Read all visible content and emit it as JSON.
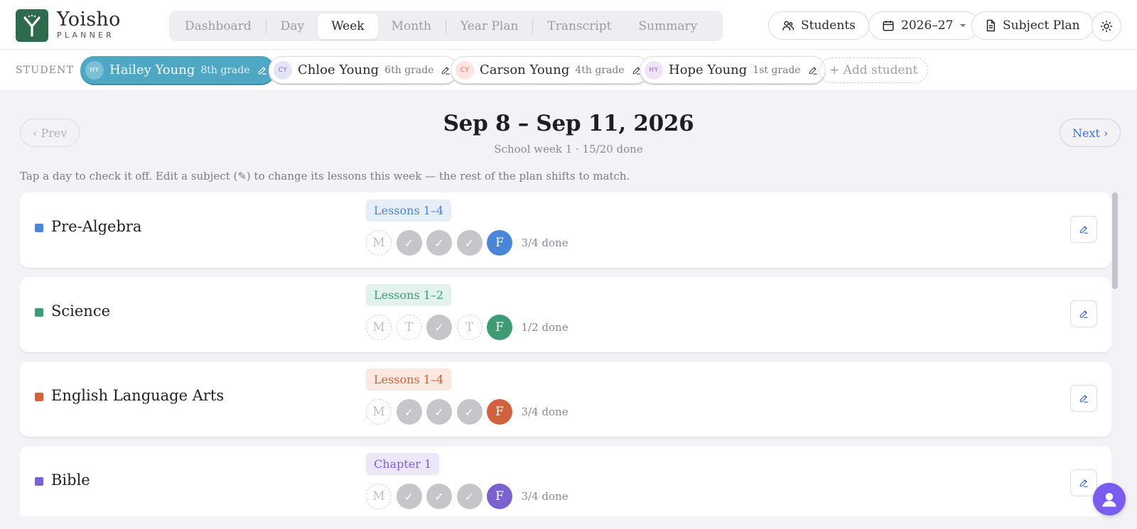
{
  "brand": {
    "name": "Yoisho",
    "subtitle": "PLANNER",
    "color": "#2e6b4e"
  },
  "tabs": [
    {
      "label": "Dashboard",
      "active": false
    },
    {
      "label": "Day",
      "active": false
    },
    {
      "label": "Week",
      "active": true
    },
    {
      "label": "Month",
      "active": false
    },
    {
      "label": "Year Plan",
      "active": false
    },
    {
      "label": "Transcript",
      "active": false
    },
    {
      "label": "Summary",
      "active": false
    }
  ],
  "header_actions": {
    "students_label": "Students",
    "year_label": "2026–27",
    "subject_plan_label": "Subject Plan",
    "theme_icon": "sun-icon"
  },
  "students": {
    "label": "STUDENT",
    "items": [
      {
        "initials": "HY",
        "name": "Hailey Young",
        "grade": "8th grade",
        "active": true,
        "avatar_bg": "#7cc0d6",
        "avatar_fg": "#ffffff"
      },
      {
        "initials": "CY",
        "name": "Chloe Young",
        "grade": "6th grade",
        "active": false,
        "avatar_bg": "#e5e3f7",
        "avatar_fg": "#7a6fc7"
      },
      {
        "initials": "CY",
        "name": "Carson Young",
        "grade": "4th grade",
        "active": false,
        "avatar_bg": "#fde4de",
        "avatar_fg": "#d96b55"
      },
      {
        "initials": "HY",
        "name": "Hope Young",
        "grade": "1st grade",
        "active": false,
        "avatar_bg": "#f1e3f7",
        "avatar_fg": "#a25cc4"
      }
    ],
    "add_label": "+ Add student"
  },
  "week": {
    "prev_label": "‹ Prev",
    "next_label": "Next ›",
    "title": "Sep 8 – Sep 11, 2026",
    "subtitle": "School week 1 · 15/20 done",
    "hint": "Tap a day to check it off. Edit a subject (✎) to change its lessons this week — the rest of the plan shifts to match."
  },
  "subjects": [
    {
      "name": "Pre-Algebra",
      "color": "#4a86d8",
      "tag_bg": "#e6eefa",
      "tag": "Lessons 1–4",
      "done": "3/4 done",
      "days": [
        {
          "label": "M",
          "state": "todo"
        },
        {
          "label": "✓",
          "state": "checked"
        },
        {
          "label": "✓",
          "state": "checked"
        },
        {
          "label": "✓",
          "state": "checked"
        },
        {
          "label": "F",
          "state": "current"
        }
      ]
    },
    {
      "name": "Science",
      "color": "#3f9b74",
      "tag_bg": "#e3f2eb",
      "tag": "Lessons 1–2",
      "done": "1/2 done",
      "days": [
        {
          "label": "M",
          "state": "todo"
        },
        {
          "label": "T",
          "state": "todo"
        },
        {
          "label": "✓",
          "state": "checked"
        },
        {
          "label": "T",
          "state": "todo"
        },
        {
          "label": "F",
          "state": "current"
        }
      ]
    },
    {
      "name": "English Language Arts",
      "color": "#d0623e",
      "tag_bg": "#fbe8e1",
      "tag": "Lessons 1–4",
      "done": "3/4 done",
      "days": [
        {
          "label": "M",
          "state": "todo"
        },
        {
          "label": "✓",
          "state": "checked"
        },
        {
          "label": "✓",
          "state": "checked"
        },
        {
          "label": "✓",
          "state": "checked"
        },
        {
          "label": "F",
          "state": "current"
        }
      ]
    },
    {
      "name": "Bible",
      "color": "#7a63d0",
      "tag_bg": "#ece8f9",
      "tag": "Chapter 1",
      "done": "3/4 done",
      "days": [
        {
          "label": "M",
          "state": "todo"
        },
        {
          "label": "✓",
          "state": "checked"
        },
        {
          "label": "✓",
          "state": "checked"
        },
        {
          "label": "✓",
          "state": "checked"
        },
        {
          "label": "F",
          "state": "current"
        }
      ]
    }
  ],
  "help_icon": "user-icon"
}
